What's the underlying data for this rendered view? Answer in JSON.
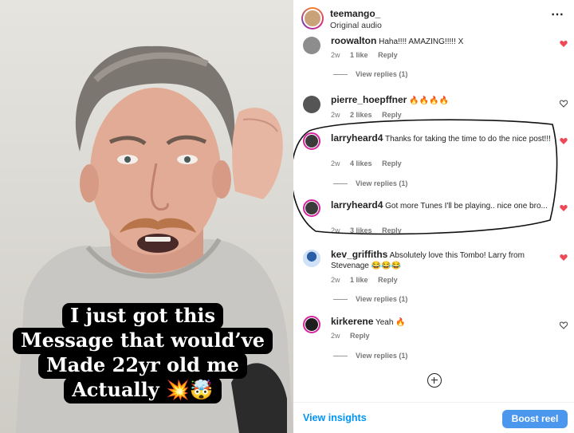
{
  "video": {
    "caption_lines": [
      "I just got this",
      "Message that would’ve",
      "Made 22yr old me",
      "Actually 💥🤯"
    ]
  },
  "header": {
    "username": "teemango_",
    "audio": "Original audio",
    "more_icon": "⋯"
  },
  "comments": [
    {
      "username": "roowalton",
      "text": "Haha!!!! AMAZING!!!!! X",
      "time": "2w",
      "likes": "1 like",
      "reply": "Reply",
      "view_replies": "View replies (1)",
      "liked": true
    },
    {
      "username": "pierre_hoepffner",
      "text": "🔥🔥🔥🔥",
      "time": "2w",
      "likes": "2 likes",
      "reply": "Reply",
      "view_replies": "",
      "liked": false
    },
    {
      "username": "larryheard4",
      "text": "Thanks for taking the time to do the nice post!!!",
      "time": "2w",
      "likes": "4 likes",
      "reply": "Reply",
      "view_replies": "View replies (1)",
      "liked": true
    },
    {
      "username": "larryheard4",
      "text": "Got more Tunes I'll be playing.. nice one bro...",
      "time": "2w",
      "likes": "3 likes",
      "reply": "Reply",
      "view_replies": "",
      "liked": true
    },
    {
      "username": "kev_griffiths",
      "text": "Absolutely love this Tombo! Larry from Stevenage 😂😂😂",
      "time": "2w",
      "likes": "1 like",
      "reply": "Reply",
      "view_replies": "View replies (1)",
      "liked": true
    },
    {
      "username": "kirkerene",
      "text": "Yeah 🔥",
      "time": "2w",
      "likes": "",
      "reply": "Reply",
      "view_replies": "View replies (1)",
      "liked": false
    }
  ],
  "footer": {
    "insights": "View insights",
    "boost": "Boost reel"
  },
  "colors": {
    "like_red": "#ed4956",
    "link_blue": "#0095f6",
    "boost_blue": "#4a97ed"
  }
}
